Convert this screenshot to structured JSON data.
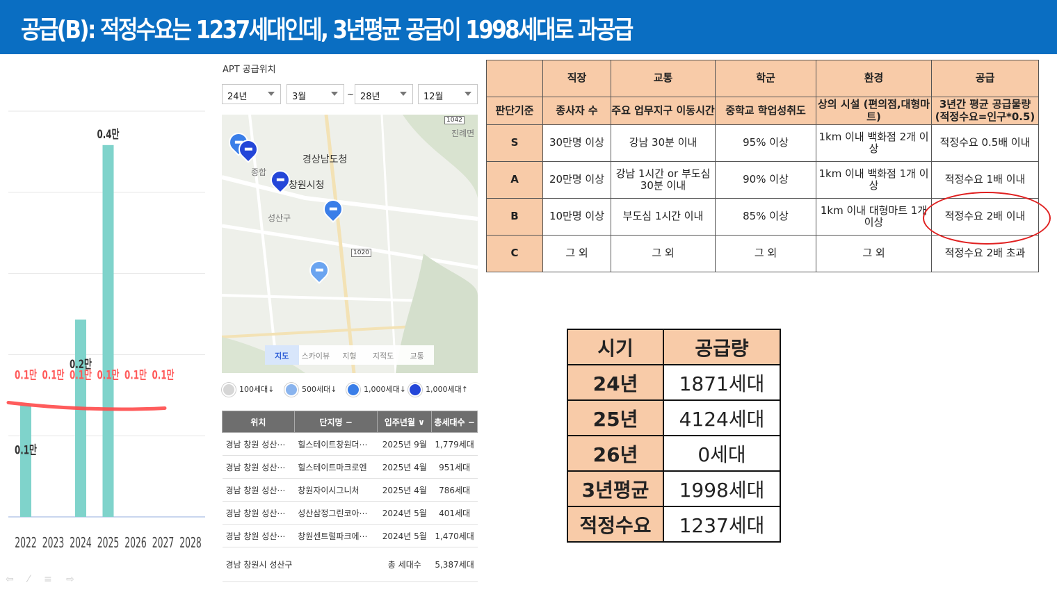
{
  "header": {
    "title": "공급(B): 적정수요는 1237세대인데, 3년평균 공급이 1998세대로 과공급"
  },
  "chart_data": {
    "type": "bar",
    "categories": [
      "2022",
      "2023",
      "2024",
      "2025",
      "2026",
      "2027",
      "2028"
    ],
    "series": [
      {
        "values": [
          1235,
          0,
          2189,
          4124,
          0,
          0,
          0
        ],
        "bar_labels": [
          "0.1만",
          "",
          "0.2만",
          "0.4만",
          "",
          "",
          ""
        ]
      },
      {
        "values": [
          1237,
          1237,
          1237,
          1237,
          1237,
          1237,
          null
        ],
        "line_labels": [
          "0.1만",
          "0.1만",
          "0.1만",
          "0.1만",
          "0.1만",
          "0.1만",
          ""
        ]
      }
    ],
    "colors": {
      "bar": "#7fd3cb",
      "line": "#ff4a4a"
    },
    "ylim": [
      0,
      4500
    ],
    "grid": true
  },
  "apt": {
    "title": "APT 공급위치",
    "filters": {
      "from_year": "24년",
      "from_month": "3월",
      "tilde": "~",
      "to_year": "28년",
      "to_month": "12월"
    },
    "map": {
      "labels": {
        "province_office": "경상남도청",
        "city_hall": "창원시청",
        "district": "성산구",
        "hospital": "종합",
        "area": "진례면"
      },
      "roads": {
        "r1042": "1042",
        "r1020": "1020"
      },
      "tabs": [
        "지도",
        "스카이뷰",
        "지형",
        "지적도",
        "교통"
      ]
    },
    "legend": [
      "100세대↓",
      "500세대↓",
      "1,000세대↓",
      "1,000세대↑"
    ],
    "table": {
      "headers": [
        "위치",
        "단지명 −",
        "입주년월 ∨",
        "총세대수 −"
      ],
      "rows": [
        [
          "경남 창원 성산⋯",
          "힐스테이트창원더⋯",
          "2025년 9월",
          "1,779세대"
        ],
        [
          "경남 창원 성산⋯",
          "힐스테이트마크로엔",
          "2025년 4월",
          "951세대"
        ],
        [
          "경남 창원 성산⋯",
          "창원자이시그니처",
          "2025년 4월",
          "786세대"
        ],
        [
          "경남 창원 성산⋯",
          "성산삼정그린코아⋯",
          "2024년 5월",
          "401세대"
        ],
        [
          "경남 창원 성산⋯",
          "창원센트럴파크에⋯",
          "2024년 5월",
          "1,470세대"
        ]
      ],
      "total": {
        "location": "경남 창원시 성산구",
        "label": "총 세대수",
        "value": "5,387세대"
      }
    }
  },
  "criteria": {
    "headers": [
      "",
      "직장",
      "교통",
      "학군",
      "환경",
      "공급"
    ],
    "basis": [
      "판단기준",
      "종사자 수",
      "주요 업무지구 이동시간",
      "중학교 학업성취도",
      "상의 시설 (편의점,대형마트)",
      "3년간 평균 공급물량 (적정수요=인구*0.5)"
    ],
    "rows": [
      [
        "S",
        "30만명 이상",
        "강남 30분 이내",
        "95% 이상",
        "1km 이내 백화점 2개 이상",
        "적정수요 0.5배 이내"
      ],
      [
        "A",
        "20만명 이상",
        "강남 1시간 or 부도심 30분 이내",
        "90% 이상",
        "1km 이내 백화점 1개 이상",
        "적정수요 1배 이내"
      ],
      [
        "B",
        "10만명 이상",
        "부도심 1시간 이내",
        "85% 이상",
        "1km 이내 대형마트 1개 이상",
        "적정수요 2배 이내"
      ],
      [
        "C",
        "그 외",
        "그 외",
        "그 외",
        "그 외",
        "적정수요 2배 초과"
      ]
    ],
    "highlight_color": "#e02020"
  },
  "supply": {
    "header": [
      "시기",
      "공급량"
    ],
    "rows": [
      [
        "24년",
        "1871세대"
      ],
      [
        "25년",
        "4124세대"
      ],
      [
        "26년",
        "0세대"
      ],
      [
        "3년평균",
        "1998세대"
      ],
      [
        "적정수요",
        "1237세대"
      ]
    ]
  }
}
